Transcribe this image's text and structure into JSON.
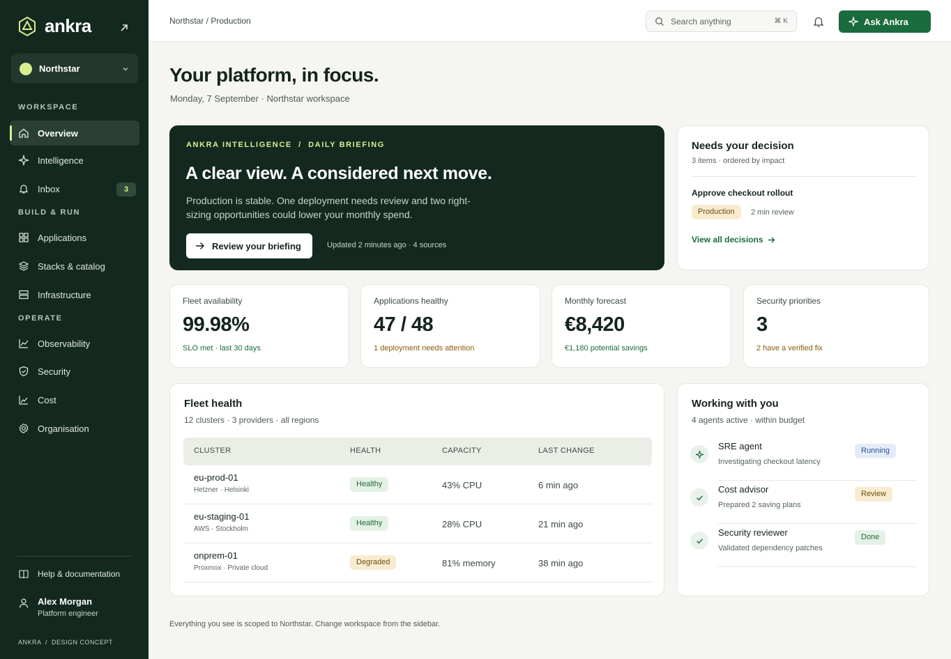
{
  "brand": {
    "name": "ankra"
  },
  "workspace": {
    "name": "Northstar"
  },
  "sidebar": {
    "sections": {
      "workspace": "WORKSPACE",
      "build": "BUILD & RUN",
      "operate": "OPERATE"
    },
    "items": [
      {
        "label": "Overview",
        "icon": "home-icon"
      },
      {
        "label": "Intelligence",
        "icon": "sparkle-icon"
      },
      {
        "label": "Inbox",
        "icon": "bell-icon",
        "badge": "3"
      },
      {
        "label": "Applications",
        "icon": "grid-icon"
      },
      {
        "label": "Stacks & catalog",
        "icon": "layers-icon"
      },
      {
        "label": "Infrastructure",
        "icon": "server-icon"
      },
      {
        "label": "Observability",
        "icon": "chart-icon"
      },
      {
        "label": "Security",
        "icon": "shield-icon"
      },
      {
        "label": "Cost",
        "icon": "trend-icon"
      },
      {
        "label": "Organisation",
        "icon": "gear-icon"
      }
    ],
    "help": "Help & documentation",
    "user": {
      "name": "Alex Morgan",
      "role": "Platform engineer"
    },
    "footer": "ANKRA  /  DESIGN CONCEPT"
  },
  "topbar": {
    "breadcrumb": "Northstar / Production",
    "search_placeholder": "Search anything",
    "search_shortcut": "⌘ K",
    "ask_label": "Ask Ankra"
  },
  "page": {
    "title": "Your platform, in focus.",
    "subtitle": "Monday, 7 September · Northstar workspace"
  },
  "hero": {
    "eyebrow": "ANKRA INTELLIGENCE  /  DAILY BRIEFING",
    "title": "A clear view. A considered next move.",
    "body": "Production is stable. One deployment needs review and two right-sizing opportunities could lower your monthly spend.",
    "button": "Review your briefing",
    "meta": "Updated 2 minutes ago · 4 sources"
  },
  "decision": {
    "title": "Needs your decision",
    "subtitle": "3 items · ordered by impact",
    "item": "Approve checkout rollout",
    "tag": "Production",
    "time": "2 min review",
    "link": "View all decisions"
  },
  "kpis": [
    {
      "label": "Fleet availability",
      "value": "99.98%",
      "note": "SLO met · last 30 days",
      "tone": "green"
    },
    {
      "label": "Applications healthy",
      "value": "47 / 48",
      "note": "1 deployment needs attention",
      "tone": "amber"
    },
    {
      "label": "Monthly forecast",
      "value": "€8,420",
      "note": "€1,180 potential savings",
      "tone": "green"
    },
    {
      "label": "Security priorities",
      "value": "3",
      "note": "2 have a verified fix",
      "tone": "amber"
    }
  ],
  "fleet": {
    "title": "Fleet health",
    "subtitle": "12 clusters · 3 providers · all regions",
    "columns": [
      "CLUSTER",
      "HEALTH",
      "CAPACITY",
      "LAST CHANGE"
    ],
    "rows": [
      {
        "name": "eu-prod-01",
        "sub": "Hetzner · Helsinki",
        "health": "Healthy",
        "capacity": "43% CPU",
        "changed": "6 min ago"
      },
      {
        "name": "eu-staging-01",
        "sub": "AWS · Stockholm",
        "health": "Healthy",
        "capacity": "28% CPU",
        "changed": "21 min ago"
      },
      {
        "name": "onprem-01",
        "sub": "Proxmox · Private cloud",
        "health": "Degraded",
        "capacity": "81% memory",
        "changed": "38 min ago"
      }
    ]
  },
  "agents": {
    "title": "Working with you",
    "subtitle": "4 agents active · within budget",
    "items": [
      {
        "name": "SRE agent",
        "desc": "Investigating checkout latency",
        "status": "Running"
      },
      {
        "name": "Cost advisor",
        "desc": "Prepared 2 saving plans",
        "status": "Review"
      },
      {
        "name": "Security reviewer",
        "desc": "Validated dependency patches",
        "status": "Done"
      }
    ]
  },
  "footer_note": "Everything you see is scoped to Northstar. Change workspace from the sidebar.",
  "colors": {
    "sidebar": "#13291f",
    "accent": "#1a6b3d",
    "lime": "#d9ee8e",
    "background": "#f5f6f2"
  }
}
